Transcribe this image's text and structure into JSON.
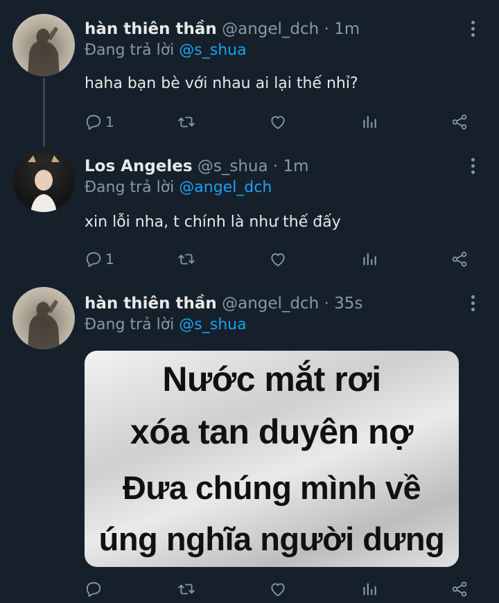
{
  "reply_prefix": "Đang trả lời",
  "tweets": [
    {
      "name": "hàn thiên thần",
      "handle": "@angel_dch",
      "time": "1m",
      "reply_to": "@s_shua",
      "text": "haha bạn bè với nhau ai lại thế nhỉ?",
      "reply_count": "1"
    },
    {
      "name": "Los Angeles",
      "handle": "@s_shua",
      "time": "1m",
      "reply_to": "@angel_dch",
      "text": "xin lỗi nha, t chính là như thế đấy",
      "reply_count": "1"
    },
    {
      "name": "hàn thiên thần",
      "handle": "@angel_dch",
      "time": "35s",
      "reply_to": "@s_shua",
      "reply_count": "",
      "media_lines": [
        "Nước mắt rơi",
        "xóa tan duyên nợ",
        "Đưa chúng mình về",
        "úng nghĩa người dưng"
      ]
    }
  ],
  "separator": "·",
  "icons": [
    "reply-icon",
    "retweet-icon",
    "like-icon",
    "analytics-icon",
    "share-icon",
    "more-icon"
  ],
  "colors": {
    "background": "#15202b",
    "accent": "#1da1f2",
    "secondary_text": "#8899a6",
    "primary_text": "#e8e8e8"
  }
}
